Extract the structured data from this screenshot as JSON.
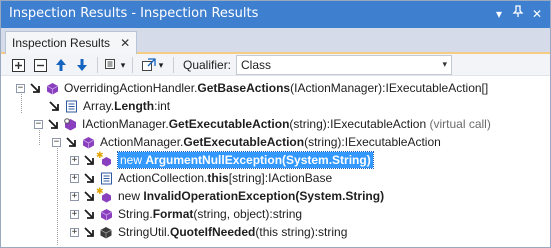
{
  "window": {
    "title": "Inspection Results - Inspection Results",
    "dropdown_glyph": "▾",
    "pin_glyph": "⊿",
    "close_glyph": "✕"
  },
  "tab": {
    "label": "Inspection Results",
    "close_glyph": "✕"
  },
  "toolbar": {
    "qualifier_label": "Qualifier:",
    "qualifier_value": "Class",
    "dropdown_glyph": "▾",
    "icons": [
      "expand-all-icon",
      "collapse-all-icon",
      "up-arrow-icon",
      "down-arrow-icon",
      "group-by-icon",
      "export-icon"
    ]
  },
  "tree": {
    "rows": [
      {
        "pre": "OverridingActionHandler.",
        "bold": "GetBaseActions",
        "post": "(IActionManager):IExecutableAction[]",
        "note": "",
        "expander": "−",
        "icon": "method-icon"
      },
      {
        "pre": "Array.",
        "bold": "Length",
        "post": ":int",
        "note": "",
        "expander": "",
        "icon": "property-icon"
      },
      {
        "pre": "IActionManager.",
        "bold": "GetExecutableAction",
        "post": "(string):IExecutableAction",
        "note": " (virtual call)",
        "expander": "−",
        "icon": "interface-method-icon"
      },
      {
        "pre": "ActionManager.",
        "bold": "GetExecutableAction",
        "post": "(string):IExecutableAction",
        "note": "",
        "expander": "−",
        "icon": "method-icon"
      },
      {
        "pre": "new ",
        "bold": "ArgumentNullException(System.String)",
        "post": "",
        "note": "",
        "expander": "+",
        "icon": "constructor-icon",
        "selected": true
      },
      {
        "pre": "ActionCollection.",
        "bold": "this",
        "post": "[string]:IActionBase",
        "note": "",
        "expander": "+",
        "icon": "indexer-icon"
      },
      {
        "pre": "new ",
        "bold": "InvalidOperationException(System.String)",
        "post": "",
        "note": "",
        "expander": "+",
        "icon": "constructor-icon"
      },
      {
        "pre": "String.",
        "bold": "Format",
        "post": "(string, object):string",
        "note": "",
        "expander": "+",
        "icon": "method-icon"
      },
      {
        "pre": "StringUtil.",
        "bold": "QuoteIfNeeded",
        "post": "(this string):string",
        "note": "",
        "expander": "+",
        "icon": "extension-method-icon"
      }
    ]
  },
  "colors": {
    "titlebar": "#3f7fd0",
    "selection": "#3399ff",
    "method_purple": "#8a3fbf",
    "arrow_dark": "#1e1e1e"
  }
}
